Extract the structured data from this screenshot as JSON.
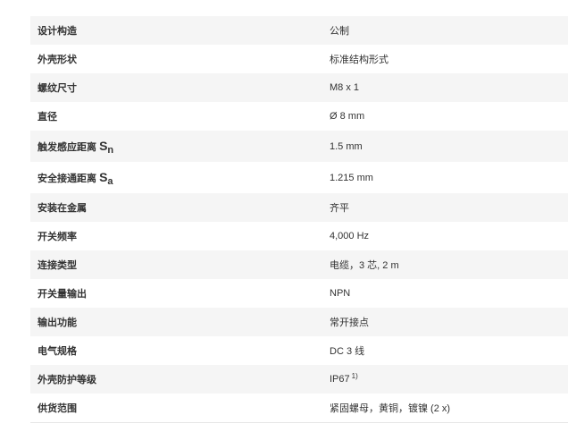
{
  "spec_rows": [
    {
      "label": "设计构造",
      "value": "公制"
    },
    {
      "label": "外壳形状",
      "value": "标准结构形式"
    },
    {
      "label": "螺纹尺寸",
      "value": "M8 x 1"
    },
    {
      "label": "直径",
      "value": "Ø 8 mm"
    },
    {
      "label": "触发感应距离",
      "symbol": "S",
      "subscript": "n",
      "value": "1.5 mm"
    },
    {
      "label": "安全接通距离",
      "symbol": "S",
      "subscript": "a",
      "value": "1.215 mm"
    },
    {
      "label": "安装在金属",
      "value": "齐平"
    },
    {
      "label": "开关频率",
      "value": "4,000 Hz"
    },
    {
      "label": "连接类型",
      "value": "电缆，3 芯, 2 m"
    },
    {
      "label": "开关量输出",
      "value": "NPN"
    },
    {
      "label": "输出功能",
      "value": "常开接点"
    },
    {
      "label": "电气规格",
      "value": "DC 3 线"
    },
    {
      "label": "外壳防护等级",
      "value": "IP67",
      "footnote": "1)"
    },
    {
      "label": "供货范围",
      "value": "紧固螺母，黄铜，镀镍 (2 x)"
    }
  ],
  "colors": {
    "row_alt_background": "#f5f5f5",
    "text": "#333333",
    "border": "#e6e6e6"
  }
}
